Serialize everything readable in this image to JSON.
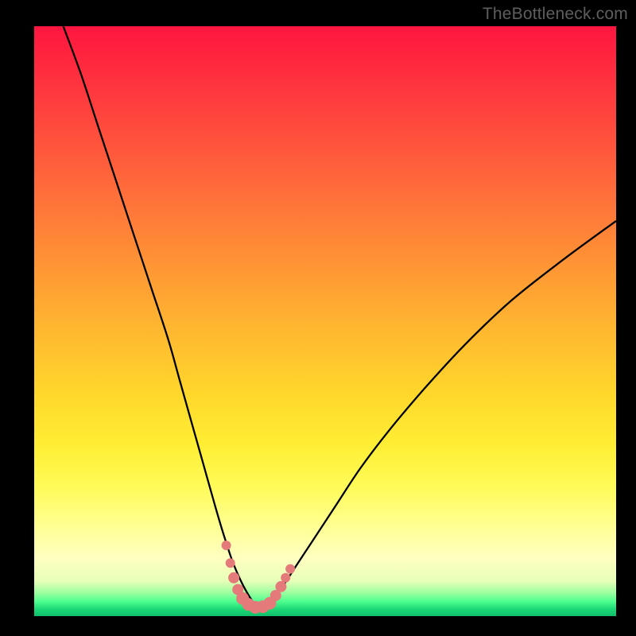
{
  "watermark": "TheBottleneck.com",
  "colors": {
    "background": "#000000",
    "curve_stroke": "#000000",
    "marker_fill": "#e47a7a",
    "gradient_top": "#ff153f",
    "gradient_bottom": "#0fbf6a"
  },
  "chart_data": {
    "type": "line",
    "title": "",
    "xlabel": "",
    "ylabel": "",
    "xlim": [
      0,
      100
    ],
    "ylim": [
      0,
      100
    ],
    "series": [
      {
        "name": "bottleneck-curve",
        "x": [
          5,
          8,
          11,
          14,
          17,
          20,
          23,
          25,
          27,
          29,
          31,
          32.5,
          34,
          35.5,
          37,
          38,
          39,
          40,
          41.5,
          43,
          45,
          48,
          52,
          56,
          61,
          67,
          74,
          82,
          91,
          100
        ],
        "y": [
          100,
          92,
          83,
          74,
          65,
          56,
          47,
          40,
          33,
          26,
          19,
          14,
          9.5,
          6,
          3.3,
          2,
          1.5,
          2,
          3.5,
          5.5,
          8.5,
          13,
          19,
          25,
          31.5,
          38.5,
          46,
          53.5,
          60.5,
          67
        ]
      }
    ],
    "markers": {
      "name": "highlighted-points",
      "x": [
        33.0,
        33.7,
        34.3,
        35.0,
        35.8,
        36.8,
        38.0,
        39.3,
        40.5,
        41.5,
        42.4,
        43.2,
        44.0
      ],
      "y": [
        12.0,
        9.0,
        6.5,
        4.5,
        3.0,
        2.0,
        1.5,
        1.6,
        2.2,
        3.5,
        5.0,
        6.5,
        8.0
      ],
      "sizes": [
        6,
        6,
        7,
        7,
        8,
        8,
        8,
        8,
        8,
        7,
        7,
        6,
        6
      ]
    }
  }
}
